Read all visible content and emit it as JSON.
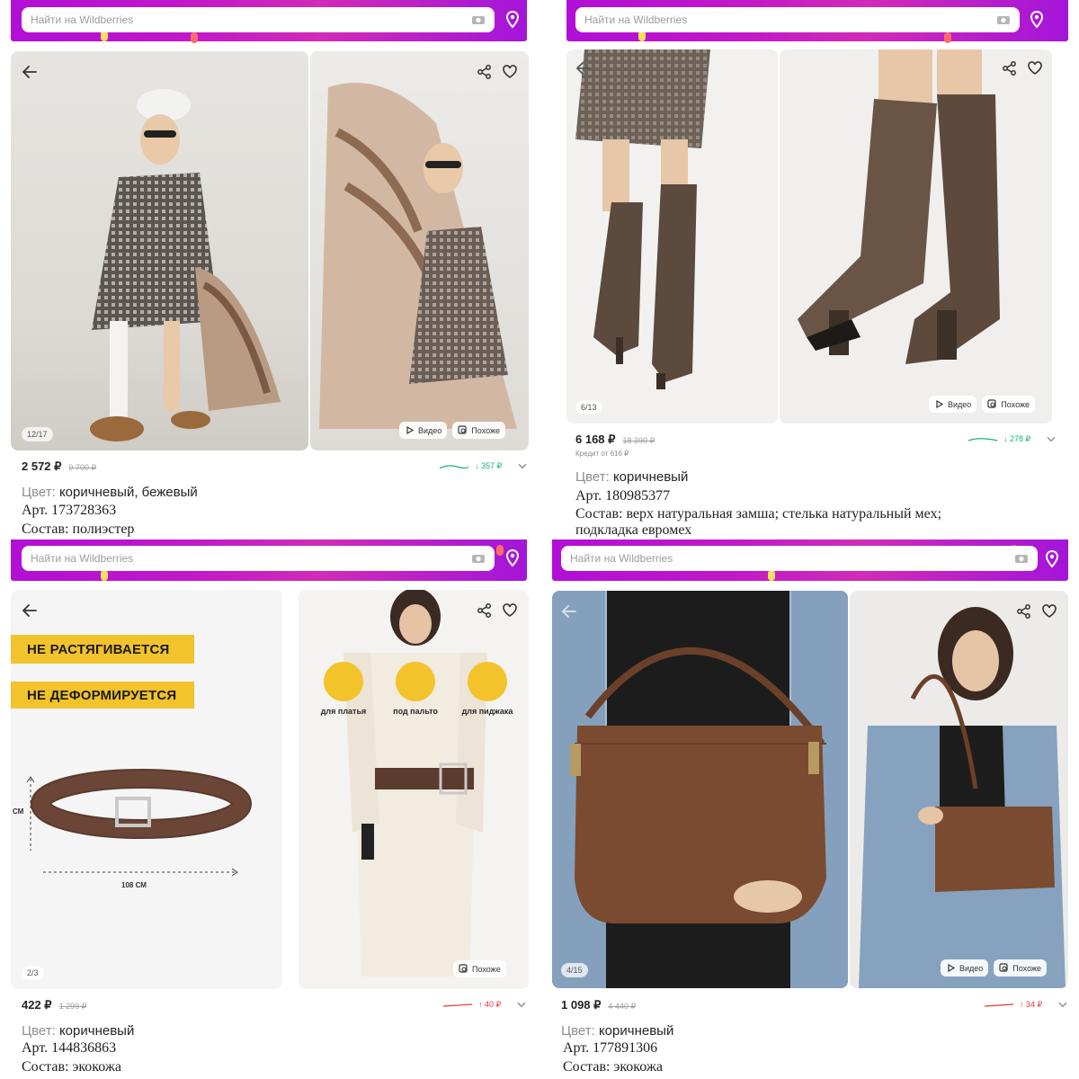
{
  "search": {
    "placeholder": "Найти на Wildberries"
  },
  "products": [
    {
      "id": "dress",
      "counter": "12/17",
      "chips": {
        "video": "Видео",
        "similar": "Похоже"
      },
      "price": "2 572 ₽",
      "old_price": "9 700 ₽",
      "trend": "↓ 357 ₽",
      "trend_color": "#14b37d",
      "color_label": "Цвет:",
      "color_value": "коричневый, бежевый",
      "article": "Арт. 173728363",
      "composition": "Состав: полиэстер"
    },
    {
      "id": "boots",
      "counter": "6/13",
      "chips": {
        "video": "Видео",
        "similar": "Похоже"
      },
      "price": "6 168 ₽",
      "old_price": "18 390 ₽",
      "credit": "Кредит от 616 ₽",
      "trend": "↓ 278 ₽",
      "trend_color": "#14b37d",
      "color_label": "Цвет:",
      "color_value": "коричневый",
      "article": "Арт. 180985377",
      "composition": "Состав: верх натуральная замша; стелька натуральный мех; подкладка евромех"
    },
    {
      "id": "belt",
      "counter": "2/3",
      "chips": {
        "similar": "Похоже"
      },
      "banner_1": "НЕ РАСТЯГИВАЕТСЯ",
      "banner_2": "НЕ ДЕФОРМИРУЕТСЯ",
      "dim_height": "СМ",
      "dim_length": "108 СМ",
      "uses": [
        "для платья",
        "под пальто",
        "для пиджака"
      ],
      "price": "422 ₽",
      "old_price": "1 299 ₽",
      "trend": "↑ 40 ₽",
      "trend_color": "#e53935",
      "color_label": "Цвет:",
      "color_value": "коричневый",
      "article": "Арт. 144836863",
      "composition": "Состав: экокожа"
    },
    {
      "id": "bag",
      "counter": "4/15",
      "chips": {
        "video": "Видео",
        "similar": "Похоже"
      },
      "price": "1 098 ₽",
      "old_price": "4 440 ₽",
      "trend": "↑ 34 ₽",
      "trend_color": "#e53935",
      "color_label": "Цвет:",
      "color_value": "коричневый",
      "article": "Арт. 177891306",
      "composition": "Состав: экокожа"
    }
  ]
}
